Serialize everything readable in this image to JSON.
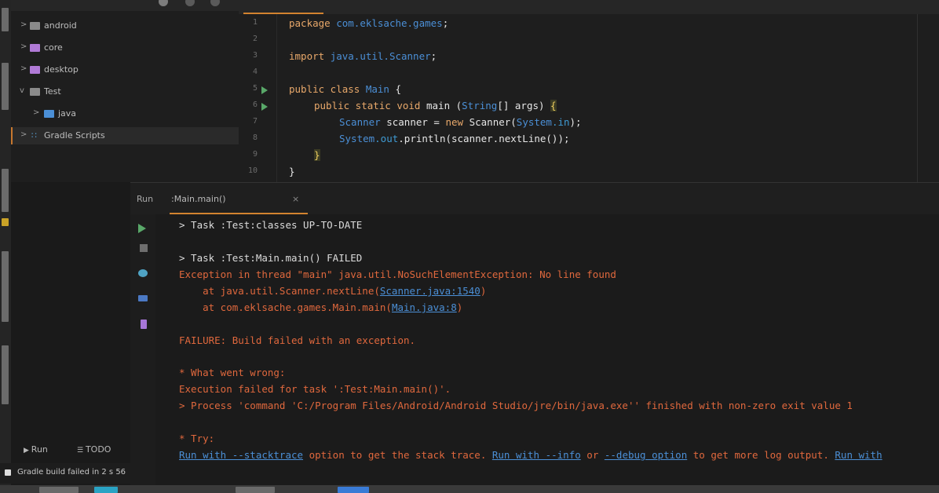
{
  "project_tree": {
    "items": [
      {
        "label": "android",
        "icon": "folder-icon"
      },
      {
        "label": "core",
        "icon": "module-folder-icon"
      },
      {
        "label": "desktop",
        "icon": "module-folder-icon"
      },
      {
        "label": "Test",
        "icon": "folder-icon"
      },
      {
        "label": "java",
        "icon": "source-folder-icon"
      },
      {
        "label": "Gradle Scripts",
        "icon": "gradle-icon"
      }
    ]
  },
  "editor": {
    "lines": [
      "1",
      "2",
      "3",
      "4",
      "5",
      "6",
      "7",
      "8",
      "9",
      "10"
    ],
    "code": {
      "l1_kw": "package",
      "l1_pkg": "com.eklsache.games",
      "l1_end": ";",
      "l3_kw": "import",
      "l3_pkg": "java.util.Scanner",
      "l3_end": ";",
      "l5_kw": "public class",
      "l5_name": "Main",
      "l5_end": " {",
      "l6_kw": "public static void",
      "l6_name": " main (",
      "l6_type": "String",
      "l6_rest": "[] args) ",
      "l6_brace": "{",
      "l7_type": "Scanner",
      "l7_rest1": " scanner = ",
      "l7_kw": "new",
      "l7_rest2": " Scanner(",
      "l7_sys": "System",
      "l7_in": ".in",
      "l7_end": ");",
      "l8_sys": "System",
      "l8_out": ".out",
      "l8_rest": ".println(scanner.nextLine());",
      "l9_brace": "}",
      "l10_brace": "}"
    }
  },
  "run": {
    "title": "Run",
    "tab_label": ":Main.main()",
    "tab_close": "×",
    "console": {
      "line1": "> Task :Test:classes UP-TO-DATE",
      "line2": "> Task :Test:Main.main() FAILED",
      "line3": "Exception in thread \"main\" java.util.NoSuchElementException: No line found",
      "line4_pre": "    at java.util.Scanner.nextLine(",
      "line4_link": "Scanner.java:1540",
      "line4_post": ")",
      "line5_pre": "    at com.eklsache.games.Main.main(",
      "line5_link": "Main.java:8",
      "line5_post": ")",
      "line6": "FAILURE: Build failed with an exception.",
      "line7": "* What went wrong:",
      "line8": "Execution failed for task ':Test:Main.main()'.",
      "line9": "> Process 'command 'C:/Program Files/Android/Android Studio/jre/bin/java.exe'' finished with non-zero exit value 1",
      "line10": "* Try:",
      "line11_link1": "Run with --stacktrace",
      "line11_t1": " option to get the stack trace. ",
      "line11_link2": "Run with --info",
      "line11_t2": " or ",
      "line11_link3": "--debug option",
      "line11_t3": " to get more log output. ",
      "line11_link4": "Run with"
    }
  },
  "bottom_tools": {
    "run_label": "Run",
    "todo_label": "TODO"
  },
  "status": {
    "text": "Gradle build failed in 2 s 56"
  },
  "colors": {
    "accent": "#d2832f",
    "error": "#e0683d",
    "link": "#4b8fd6",
    "keyword": "#e8a86a"
  }
}
